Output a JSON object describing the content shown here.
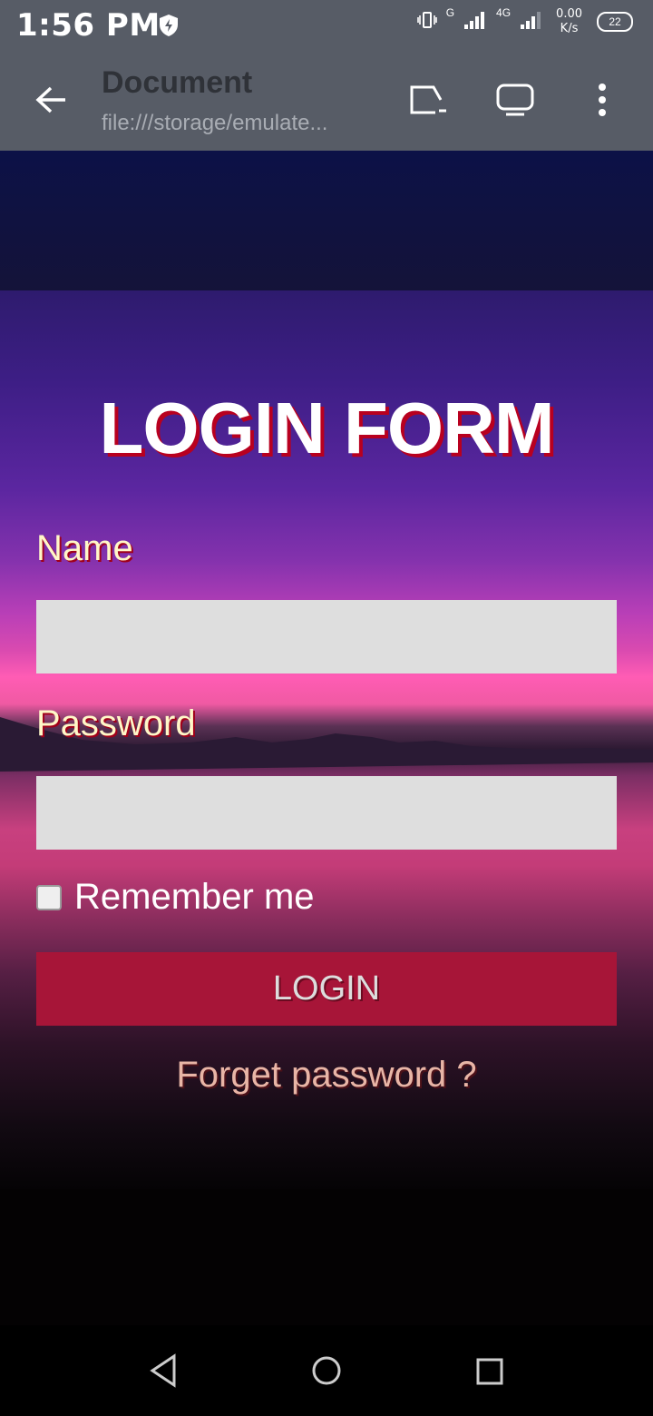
{
  "status_bar": {
    "time": "1:56 PM",
    "net_type_1": "G",
    "net_type_2": "4G",
    "speed_value": "0.00",
    "speed_unit": "K/s",
    "battery": "22"
  },
  "browser": {
    "title": "Document",
    "url": "file:///storage/emulate..."
  },
  "form": {
    "title": "LOGIN FORM",
    "name_label": "Name",
    "name_value": "",
    "password_label": "Password",
    "password_value": "",
    "remember_label": "Remember me",
    "remember_checked": false,
    "login_button": "LOGIN",
    "forgot_link": "Forget password ?"
  },
  "icons": [
    "shield-icon",
    "vibrate-icon",
    "signal-icon",
    "back-arrow-icon",
    "cast-icon",
    "desktop-icon",
    "more-vert-icon",
    "nav-back-icon",
    "nav-home-icon",
    "nav-recents-icon"
  ]
}
